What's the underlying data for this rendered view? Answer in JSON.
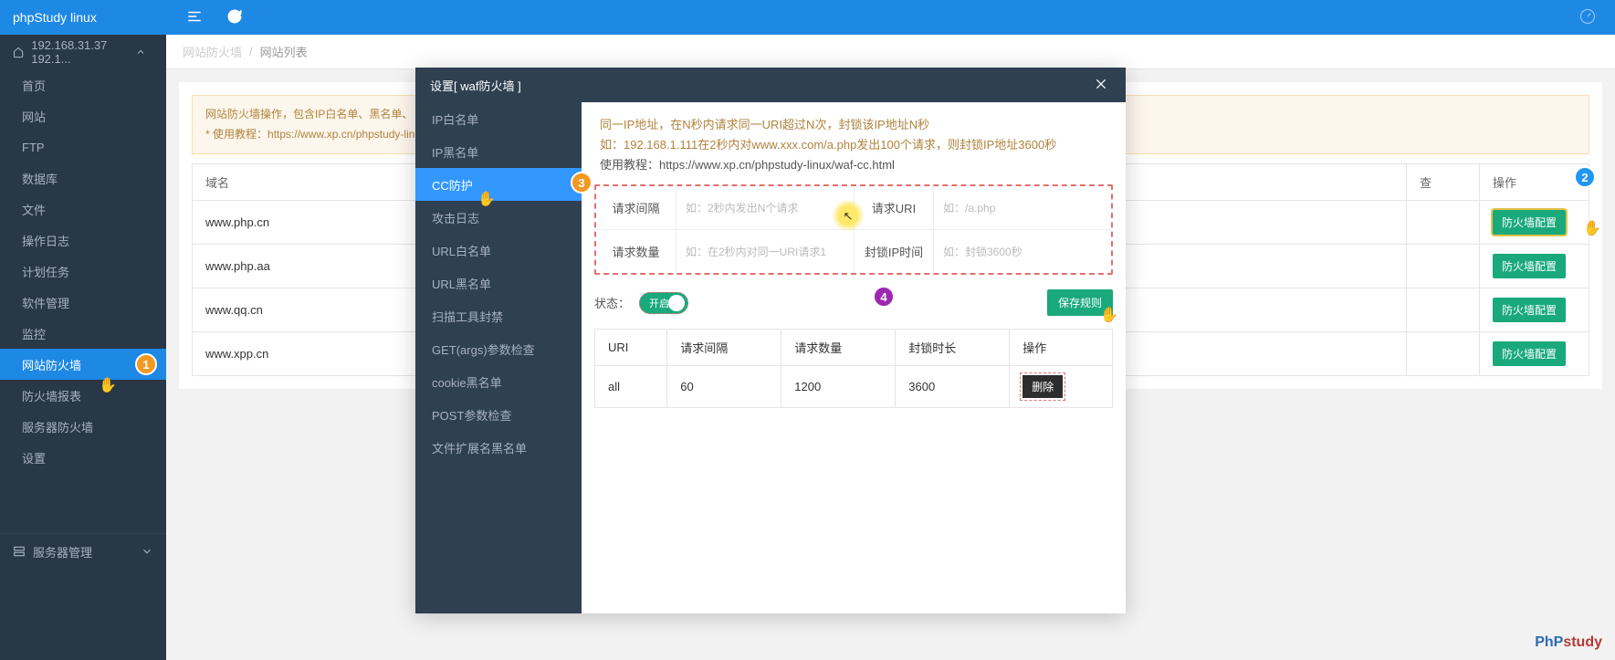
{
  "topbar": {
    "title": "phpStudy linux"
  },
  "server_selector": {
    "label": "192.168.31.37 192.1..."
  },
  "sidebar": {
    "items": [
      {
        "label": "首页"
      },
      {
        "label": "网站"
      },
      {
        "label": "FTP"
      },
      {
        "label": "数据库"
      },
      {
        "label": "文件"
      },
      {
        "label": "操作日志"
      },
      {
        "label": "计划任务"
      },
      {
        "label": "软件管理"
      },
      {
        "label": "监控"
      },
      {
        "label": "网站防火墙"
      },
      {
        "label": "防火墙报表"
      },
      {
        "label": "服务器防火墙"
      },
      {
        "label": "设置"
      }
    ],
    "mgmt_label": "服务器管理"
  },
  "breadcrumb": {
    "a": "网站防火墙",
    "b": "网站列表"
  },
  "page_alert": {
    "line1": "网站防火墙操作，包含IP白名单、黑名单、",
    "line2_prefix": "* 使用教程：",
    "line2_url": "https://www.xp.cn/phpstudy-lin"
  },
  "domain_table": {
    "header": {
      "domain": "域名",
      "check": "查",
      "action": "操作"
    },
    "rows": [
      {
        "domain": "www.php.cn",
        "btn": "防火墙配置"
      },
      {
        "domain": "www.php.aa",
        "btn": "防火墙配置"
      },
      {
        "domain": "www.qq.cn",
        "btn": "防火墙配置"
      },
      {
        "domain": "www.xpp.cn",
        "btn": "防火墙配置"
      }
    ]
  },
  "modal": {
    "title": "设置[ waf防火墙 ]",
    "nav": [
      {
        "label": "IP白名单"
      },
      {
        "label": "IP黑名单"
      },
      {
        "label": "CC防护"
      },
      {
        "label": "攻击日志"
      },
      {
        "label": "URL白名单"
      },
      {
        "label": "URL黑名单"
      },
      {
        "label": "扫描工具封禁"
      },
      {
        "label": "GET(args)参数检查"
      },
      {
        "label": "cookie黑名单"
      },
      {
        "label": "POST参数检查"
      },
      {
        "label": "文件扩展名黑名单"
      }
    ],
    "tip": {
      "l1": "同一IP地址，在N秒内请求同一URI超过N次，封锁该IP地址N秒",
      "l2": "如：192.168.1.111在2秒内对www.xxx.com/a.php发出100个请求，则封锁IP地址3600秒",
      "l3_prefix": "使用教程：",
      "l3_url": "https://www.xp.cn/phpstudy-linux/waf-cc.html"
    },
    "form": {
      "interval_label": "请求间隔",
      "interval_ph": "如：2秒内发出N个请求",
      "uri_label": "请求URI",
      "uri_ph": "如：/a.php",
      "count_label": "请求数量",
      "count_ph": "如：在2秒内对同一URI请求1",
      "block_label": "封锁IP时间",
      "block_ph": "如：封锁3600秒"
    },
    "status": {
      "label": "状态：",
      "on_text": "开启",
      "save_btn": "保存规则"
    },
    "rules_header": {
      "uri": "URI",
      "interval": "请求间隔",
      "count": "请求数量",
      "block": "封锁时长",
      "action": "操作"
    },
    "rules": [
      {
        "uri": "all",
        "interval": "60",
        "count": "1200",
        "block": "3600",
        "del": "删除"
      }
    ]
  },
  "badges": {
    "b1": "1",
    "b2": "2",
    "b3": "3",
    "b4": "4"
  },
  "logo": {
    "p1": "PhP",
    "p2": "study"
  }
}
